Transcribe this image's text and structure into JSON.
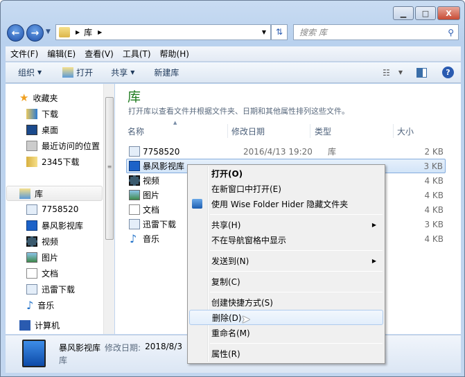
{
  "window": {
    "minimize": "▁",
    "maximize": "□",
    "close": "X"
  },
  "address": {
    "crumb": "库",
    "search_placeholder": "搜索 库"
  },
  "menubar": [
    "文件(F)",
    "编辑(E)",
    "查看(V)",
    "工具(T)",
    "帮助(H)"
  ],
  "toolbar": {
    "organize": "组织",
    "open": "打开",
    "share": "共享",
    "new_library": "新建库"
  },
  "nav": {
    "favorites": "收藏夹",
    "fav_items": [
      "下载",
      "桌面",
      "最近访问的位置",
      "2345下载"
    ],
    "libraries": "库",
    "lib_items": [
      "7758520",
      "暴风影视库",
      "视频",
      "图片",
      "文档",
      "迅雷下载",
      "音乐"
    ],
    "computer": "计算机"
  },
  "content": {
    "title": "库",
    "subtitle": "打开库以查看文件并根据文件夹、日期和其他属性排列这些文件。",
    "columns": [
      "名称",
      "修改日期",
      "类型",
      "大小"
    ],
    "rows": [
      {
        "name": "7758520",
        "date": "2016/4/13 19:20",
        "type": "库",
        "size": "2 KB"
      },
      {
        "name": "暴风影视库",
        "date": "",
        "type": "",
        "size": "3 KB"
      },
      {
        "name": "视频",
        "date": "",
        "type": "",
        "size": "4 KB"
      },
      {
        "name": "图片",
        "date": "",
        "type": "",
        "size": "4 KB"
      },
      {
        "name": "文档",
        "date": "",
        "type": "",
        "size": "4 KB"
      },
      {
        "name": "迅雷下载",
        "date": "",
        "type": "",
        "size": "3 KB"
      },
      {
        "name": "音乐",
        "date": "",
        "type": "",
        "size": "4 KB"
      }
    ]
  },
  "details": {
    "name": "暴风影视库",
    "date_label": "修改日期:",
    "date": "2018/8/3",
    "type": "库"
  },
  "context_menu": {
    "open": "打开(O)",
    "open_new": "在新窗口中打开(E)",
    "wise": "使用 Wise Folder Hider 隐藏文件夹",
    "share": "共享(H)",
    "hide_nav": "不在导航窗格中显示",
    "send_to": "发送到(N)",
    "copy": "复制(C)",
    "shortcut": "创建快捷方式(S)",
    "delete": "删除(D)",
    "rename": "重命名(M)",
    "properties": "属性(R)"
  },
  "colors": {
    "title": "#1e7b1e",
    "highlight": "#dbeaf9"
  }
}
